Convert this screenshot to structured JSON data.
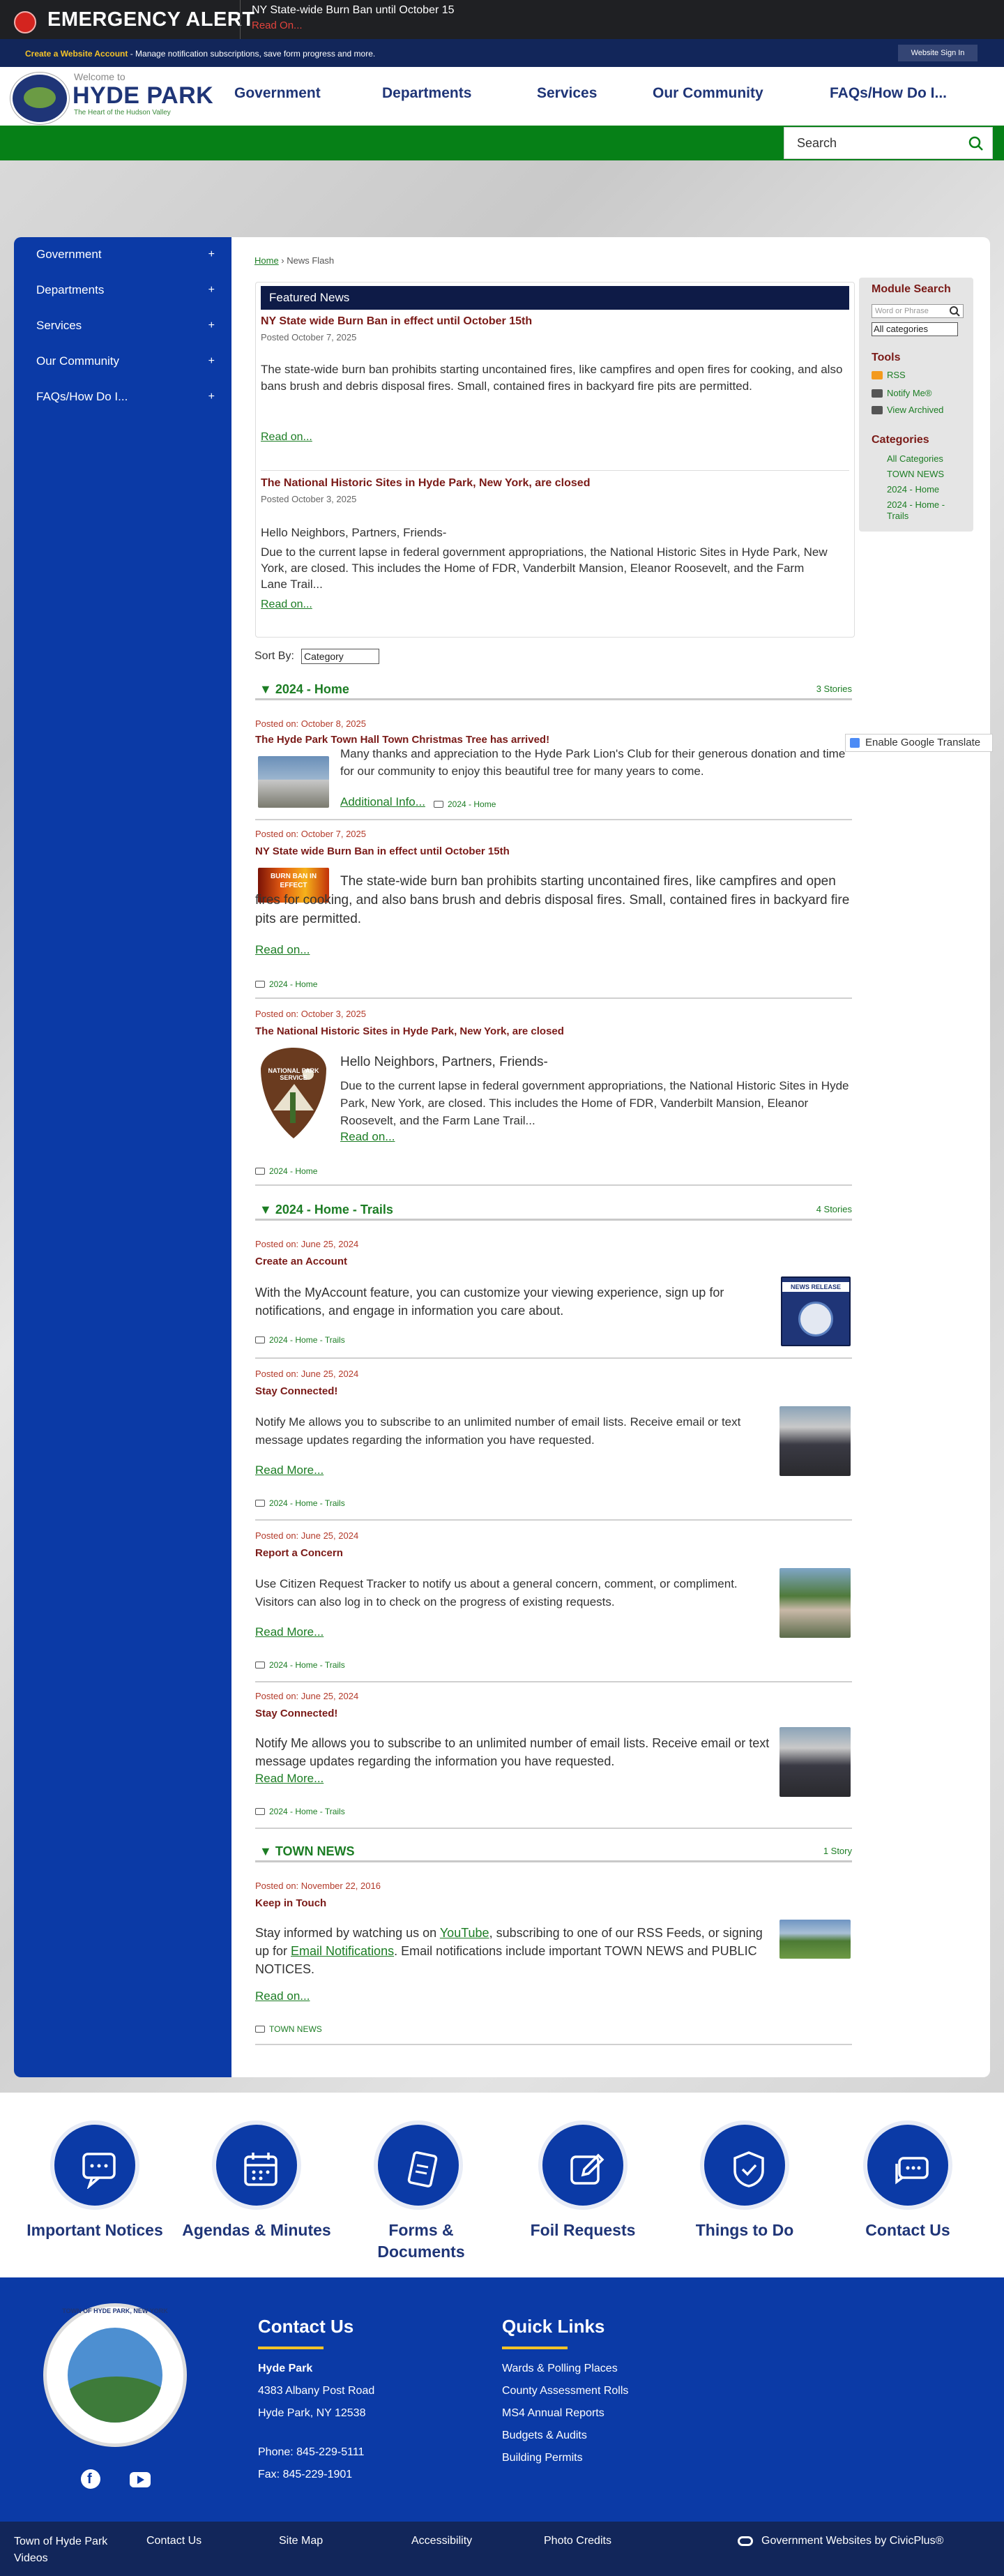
{
  "alert": {
    "title": "EMERGENCY ALERT",
    "message": "NY State-wide Burn Ban until October 15",
    "link": "Read On..."
  },
  "account": {
    "create_link": "Create a Website Account",
    "create_text": " - Manage notification subscriptions, save form progress and more.",
    "signin": "Website Sign In"
  },
  "logo": {
    "welcome": "Welcome to",
    "name": "HYDE PARK",
    "tagline": "The Heart of the Hudson Valley"
  },
  "nav": {
    "items": [
      "Government",
      "Departments",
      "Services",
      "Our Community",
      "FAQs/How Do I..."
    ]
  },
  "search": {
    "placeholder": "Search"
  },
  "sidenav": {
    "items": [
      "Government",
      "Departments",
      "Services",
      "Our Community",
      "FAQs/How Do I..."
    ]
  },
  "breadcrumb": {
    "home": "Home",
    "sep": " › ",
    "current": "News Flash"
  },
  "featured": {
    "heading": "Featured News",
    "items": [
      {
        "title": "NY State wide Burn Ban in effect until October 15th",
        "date": "Posted October 7, 2025",
        "body": "The state-wide burn ban prohibits starting uncontained fires, like campfires and open fires for cooking, and also bans brush and debris disposal fires. Small, contained fires in backyard fire pits are permitted.",
        "link": "Read on..."
      },
      {
        "title": "The National Historic Sites in Hyde Park, New York, are closed",
        "date": "Posted October 3, 2025",
        "greeting": "Hello Neighbors, Partners, Friends-",
        "body": "Due to the current lapse in federal government appropriations, the National Historic Sites in Hyde Park, New York, are closed. This includes the Home of FDR, Vanderbilt Mansion, Eleanor Roosevelt, and the Farm Lane Trail...",
        "link": "Read on..."
      }
    ]
  },
  "module": {
    "search_heading": "Module Search",
    "search_placeholder": "Word or Phrase",
    "select_value": "All categories",
    "tools_heading": "Tools",
    "tools": [
      "RSS",
      "Notify Me®",
      "View Archived"
    ],
    "categories_heading": "Categories",
    "categories": [
      "All Categories",
      "TOWN NEWS",
      "2024 - Home",
      "2024 - Home -",
      "Trails"
    ]
  },
  "sort": {
    "label": "Sort By:",
    "value": "Category"
  },
  "translate": {
    "label": "Enable Google Translate"
  },
  "sections": [
    {
      "name": "▼ 2024 - Home",
      "count": "3 Stories",
      "posts": [
        {
          "date": "Posted on: October 8, 2025",
          "title": "The Hyde Park Town Hall Town Christmas Tree has arrived!",
          "body": "Many thanks and appreciation to the Hyde Park Lion's Club for their generous donation and time for our community to enjoy this beautiful tree for many years to come.",
          "link": "Additional Info...",
          "cat": "2024 - Home"
        },
        {
          "date": "Posted on: October 7, 2025",
          "title": "NY State wide Burn Ban in effect until October 15th",
          "body": "The state-wide burn ban prohibits starting uncontained fires, like campfires and open fires for cooking, and also bans brush and debris disposal fires. Small, contained fires in backyard fire pits are permitted.",
          "link": "Read on...",
          "cat": "2024 - Home",
          "thumb_text": "BURN BAN IN EFFECT"
        },
        {
          "date": "Posted on: October 3, 2025",
          "title": "The National Historic Sites in Hyde Park, New York, are closed",
          "greeting": "Hello Neighbors, Partners, Friends-",
          "body": "Due to the current lapse in federal government appropriations, the National Historic Sites in Hyde Park, New York, are closed. This includes the Home of FDR, Vanderbilt Mansion, Eleanor Roosevelt, and the Farm Lane Trail...",
          "link": "Read on...",
          "cat": "2024 - Home",
          "thumb_text": "NATIONAL PARK SERVICE"
        }
      ]
    },
    {
      "name": "▼ 2024 - Home - Trails",
      "count": "4 Stories",
      "posts": [
        {
          "date": "Posted on: June 25, 2024",
          "title": "Create an Account",
          "body": "With the MyAccount feature, you can customize your viewing experience, sign up for notifications, and engage in information you care about.",
          "cat": "2024 - Home - Trails",
          "thumb_text": "NEWS RELEASE"
        },
        {
          "date": "Posted on: June 25, 2024",
          "title": "Stay Connected!",
          "body": "Notify Me allows you to subscribe to an unlimited number of email lists. Receive email or text message updates regarding the information you have requested.",
          "link": "Read More...",
          "cat": "2024 - Home - Trails"
        },
        {
          "date": "Posted on: June 25, 2024",
          "title": "Report a Concern",
          "body": "Use Citizen Request Tracker to notify us about a general concern, comment, or compliment. Visitors can also log in to check on the progress of existing requests.",
          "link": "Read More...",
          "cat": "2024 - Home - Trails"
        },
        {
          "date": "Posted on: June 25, 2024",
          "title": "Stay Connected!",
          "body": "Notify Me allows you to subscribe to an unlimited number of email lists. Receive email or text message updates regarding the information you have requested.",
          "link": "Read More...",
          "cat": "2024 - Home - Trails"
        }
      ]
    },
    {
      "name": "▼ TOWN NEWS",
      "count": "1 Story",
      "posts": [
        {
          "date": "Posted on: November 22, 2016",
          "title": "Keep in Touch",
          "body_a": "Stay informed by watching us on ",
          "youtube": "YouTube",
          "body_b": ", subscribing to one of our RSS Feeds, or signing up for ",
          "email": "Email Notifications",
          "body_c": ". Email notifications include important TOWN NEWS and PUBLIC NOTICES.",
          "link": "Read on...",
          "cat": "TOWN NEWS"
        }
      ]
    }
  ],
  "quicklinks": [
    "Important Notices",
    "Agendas & Minutes",
    "Forms & Documents",
    "Foil Requests",
    "Things to Do",
    "Contact Us"
  ],
  "footer": {
    "contact_heading": "Contact Us",
    "org": "Hyde Park",
    "addr1": "4383 Albany Post Road",
    "addr2": "Hyde Park, NY 12538",
    "phone": "Phone: 845-229-5111",
    "fax": "Fax: 845-229-1901",
    "quick_heading": "Quick Links",
    "quick": [
      "Wards & Polling Places",
      "County Assessment Rolls",
      "MS4 Annual Reports",
      "Budgets & Audits",
      "Building Permits"
    ],
    "seal_text": "TOWN OF HYDE PARK, NEW YORK"
  },
  "bottom": {
    "links": [
      "Town of Hyde Park Videos",
      "Contact Us",
      "Site Map",
      "Accessibility",
      "Photo Credits"
    ],
    "civic": "Government Websites by CivicPlus®"
  },
  "colors": {
    "primary": "#0b3aa6",
    "green": "#068017",
    "maroon": "#7a1a17",
    "alert_red": "#d4241f",
    "accent_yellow": "#f5c327"
  }
}
